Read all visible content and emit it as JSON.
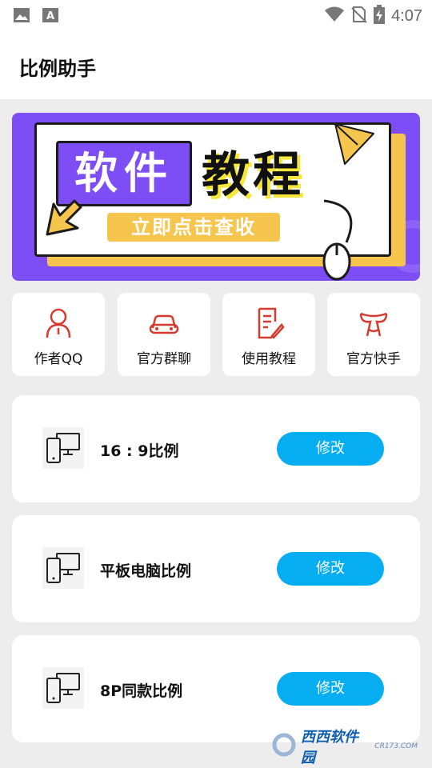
{
  "status_bar": {
    "time": "4:07",
    "icons": [
      "image-icon",
      "a-notification-icon",
      "wifi-icon",
      "no-sim-icon",
      "battery-charging-icon"
    ]
  },
  "app_bar": {
    "title": "比例助手"
  },
  "banner": {
    "tag": "软件",
    "title": "教程",
    "cta": "立即点击查收",
    "colors": {
      "background": "#7d4df6",
      "yellow": "#f6c54d",
      "highlight": "#f6e63a"
    }
  },
  "quick_actions": [
    {
      "label": "作者QQ",
      "icon": "person-icon"
    },
    {
      "label": "官方群聊",
      "icon": "car-icon"
    },
    {
      "label": "使用教程",
      "icon": "document-edit-icon"
    },
    {
      "label": "官方快手",
      "icon": "kuaishou-icon"
    }
  ],
  "ratio_items": [
    {
      "label": "16 : 9比例",
      "button": "修改",
      "icon": "devices-icon"
    },
    {
      "label": "平板电脑比例",
      "button": "修改",
      "icon": "devices-icon"
    },
    {
      "label": "8P同款比例",
      "button": "修改",
      "icon": "devices-icon"
    }
  ],
  "watermark": {
    "main": "西西软件园",
    "sub": "CR173.COM"
  },
  "accent_color": "#06aef1",
  "icon_color": "#d63a2e"
}
